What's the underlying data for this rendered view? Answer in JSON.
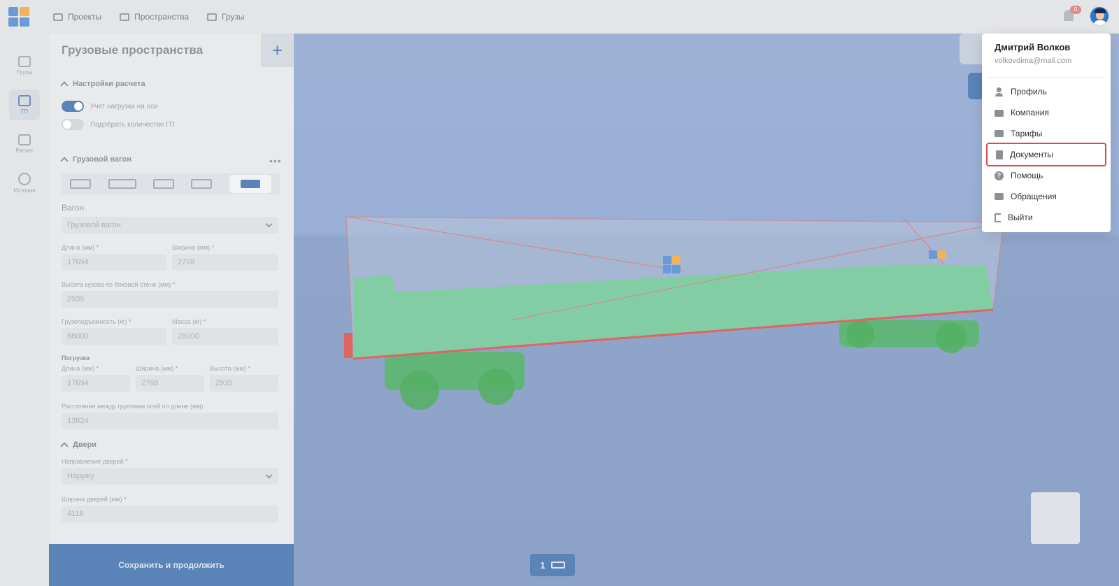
{
  "topnav": {
    "items": [
      {
        "label": "Проекты",
        "icon": "folder-icon"
      },
      {
        "label": "Пространства",
        "icon": "space-icon"
      },
      {
        "label": "Грузы",
        "icon": "cargo-icon"
      }
    ],
    "notification_count": "0"
  },
  "sidebar": {
    "items": [
      {
        "label": "Грузы",
        "icon": "cargo-icon"
      },
      {
        "label": "ГП",
        "icon": "space-icon"
      },
      {
        "label": "Расчет",
        "icon": "grid-icon"
      },
      {
        "label": "История",
        "icon": "clock-icon"
      }
    ]
  },
  "panel": {
    "title": "Грузовые пространства",
    "settings_title": "Настройки расчета",
    "toggle1_label": "Учет нагрузки на оси",
    "toggle1_on": true,
    "toggle2_label": "Подобрать количество ГП",
    "toggle2_on": false,
    "wagon_title": "Грузовой вагон",
    "wagon_label": "Вагон",
    "wagon_value": "Грузовой вагон",
    "length_label": "Длина (мм) *",
    "length_value": "17694",
    "width_label": "Ширина (мм) *",
    "width_value": "2768",
    "side_height_label": "Высота кузова по боковой стене (мм) *",
    "side_height_value": "2935",
    "capacity_label": "Грузоподъемность (кг) *",
    "capacity_value": "68000",
    "mass_label": "Масса (кг) *",
    "mass_value": "26000",
    "loading_title": "Погрузка",
    "load_length_label": "Длина (мм) *",
    "load_length_value": "17694",
    "load_width_label": "Ширина (мм) *",
    "load_width_value": "2768",
    "load_height_label": "Высота (мм) *",
    "load_height_value": "2935",
    "axle_distance_label": "Расстояние между группами осей по длине (мм)",
    "axle_distance_value": "13824",
    "doors_title": "Двери",
    "door_direction_label": "Направление дверей *",
    "door_direction_value": "Наружу",
    "door_width_label": "Ширина дверей (мм) *",
    "door_width_value": "4118",
    "save_button": "Сохранить и продолжить"
  },
  "viewport": {
    "page_number": "1"
  },
  "user_menu": {
    "name": "Дмитрий Волков",
    "email": "volkovdima@mail.com",
    "items": [
      {
        "label": "Профиль",
        "icon": "user-icon"
      },
      {
        "label": "Компания",
        "icon": "briefcase-icon"
      },
      {
        "label": "Тарифы",
        "icon": "card-icon"
      },
      {
        "label": "Документы",
        "icon": "document-icon",
        "highlighted": true
      },
      {
        "label": "Помощь",
        "icon": "help-icon"
      },
      {
        "label": "Обращения",
        "icon": "chat-icon"
      },
      {
        "label": "Выйти",
        "icon": "logout-icon"
      }
    ]
  },
  "colors": {
    "accent": "#5a83b8",
    "highlight_border": "#e0484c",
    "cargo_green": "#78c99a",
    "wagon_red": "#e06464"
  }
}
